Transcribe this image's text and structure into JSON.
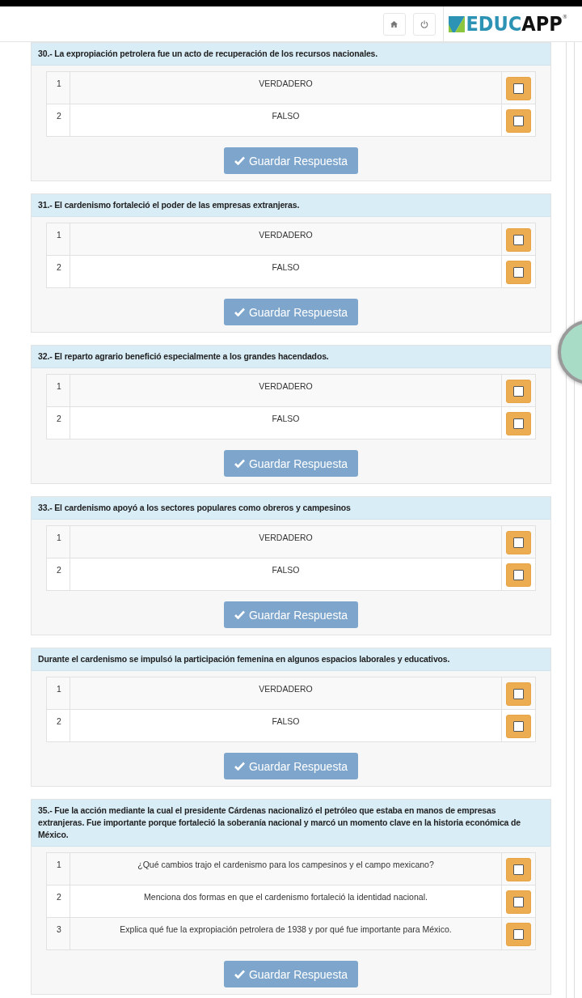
{
  "header": {
    "logo": {
      "part_1": "EDUC",
      "part_2": "APP",
      "mark": "®"
    }
  },
  "questions": [
    {
      "title": "30.- La expropiación petrolera fue un acto de recuperación de los recursos nacionales.",
      "options": [
        {
          "number": "1",
          "text": "VERDADERO",
          "checked": false
        },
        {
          "number": "2",
          "text": "FALSO",
          "checked": false
        }
      ],
      "button": "Guardar Respuesta"
    },
    {
      "title": "31.- El cardenismo fortaleció el poder de las empresas extranjeras.",
      "options": [
        {
          "number": "1",
          "text": "VERDADERO",
          "checked": false
        },
        {
          "number": "2",
          "text": "FALSO",
          "checked": false
        }
      ],
      "button": "Guardar Respuesta"
    },
    {
      "title": "32.- El reparto agrario benefició especialmente a los grandes hacendados.",
      "options": [
        {
          "number": "1",
          "text": "VERDADERO",
          "checked": false
        },
        {
          "number": "2",
          "text": "FALSO",
          "checked": false
        }
      ],
      "button": "Guardar Respuesta"
    },
    {
      "title": "33.- El cardenismo apoyó a los sectores populares como obreros y campesinos",
      "options": [
        {
          "number": "1",
          "text": "VERDADERO",
          "checked": false
        },
        {
          "number": "2",
          "text": "FALSO",
          "checked": false
        }
      ],
      "button": "Guardar Respuesta"
    },
    {
      "title": "Durante el cardenismo se impulsó la participación femenina en algunos espacios laborales y educativos.",
      "options": [
        {
          "number": "1",
          "text": "VERDADERO",
          "checked": false
        },
        {
          "number": "2",
          "text": "FALSO",
          "checked": false
        }
      ],
      "button": "Guardar Respuesta"
    },
    {
      "title": "35.- Fue la acción mediante la cual el presidente Cárdenas nacionalizó el petróleo que estaba en manos de empresas extranjeras. Fue importante porque fortaleció la soberanía nacional y marcó un momento clave en la historia económica de México.",
      "options": [
        {
          "number": "1",
          "text": "¿Qué cambios trajo el cardenismo para los campesinos y el campo mexicano?",
          "checked": false
        },
        {
          "number": "2",
          "text": "Menciona dos formas en que el cardenismo fortaleció la identidad nacional.",
          "checked": false
        },
        {
          "number": "3",
          "text": "Explica qué fue la expropiación petrolera de 1938 y por qué fue importante para México.",
          "checked": false
        }
      ],
      "button": "Guardar Respuesta"
    }
  ]
}
